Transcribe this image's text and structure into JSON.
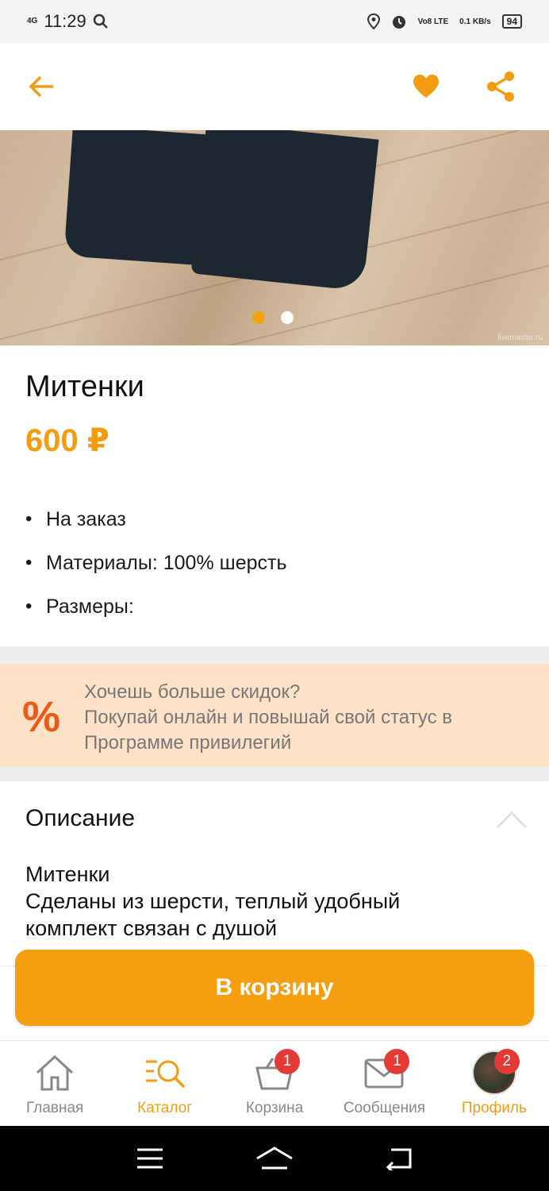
{
  "status_bar": {
    "network": "4G",
    "time": "11:29",
    "volte": "Vo8 LTE",
    "speed": "0.1 KB/s",
    "battery": "94"
  },
  "header": {
    "back_icon": "arrow-left-icon",
    "favorite_icon": "heart-icon",
    "share_icon": "share-icon",
    "accent_color": "#f39c12"
  },
  "gallery": {
    "slides_count": 2,
    "active_slide": 1,
    "watermark": "livemaster.ru"
  },
  "product": {
    "title": "Митенки",
    "price": "600 ₽",
    "properties": [
      "На заказ",
      "Материалы: 100% шерсть",
      "Размеры:"
    ]
  },
  "promo": {
    "icon": "%",
    "text": "Хочешь больше скидок?\nПокупай онлайн и повышай свой статус в Программе привилегий"
  },
  "description": {
    "title": "Описание",
    "lines": [
      "Митенки",
      "Сделаны из шерсти, теплый удобный\nкомплект связан с душой"
    ]
  },
  "cart_button": {
    "label": "В корзину"
  },
  "bottom_nav": {
    "items": [
      {
        "label": "Главная",
        "icon": "home-icon"
      },
      {
        "label": "Каталог",
        "icon": "catalog-search-icon"
      },
      {
        "label": "Корзина",
        "icon": "basket-icon",
        "badge": "1"
      },
      {
        "label": "Сообщения",
        "icon": "mail-icon",
        "badge": "1"
      },
      {
        "label": "Профиль",
        "icon": "avatar",
        "badge": "2"
      }
    ],
    "active_index": 1
  }
}
